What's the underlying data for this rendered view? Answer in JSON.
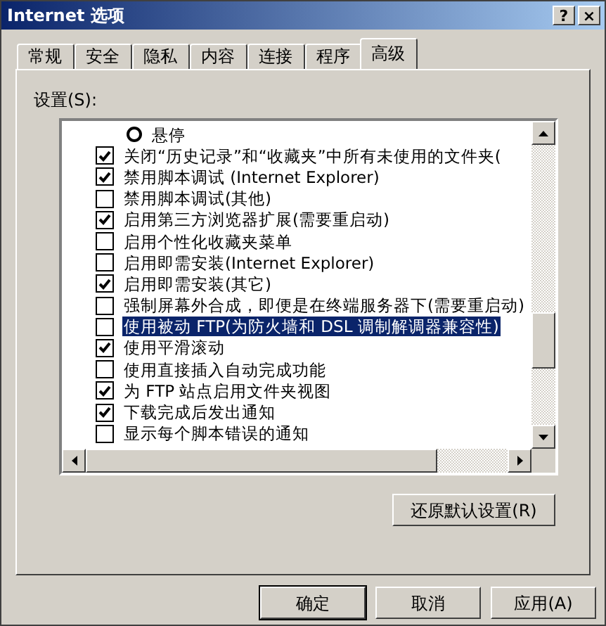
{
  "window": {
    "title": "Internet 选项",
    "title_buttons": [
      "?",
      "×"
    ]
  },
  "tabs": [
    {
      "label": "常规",
      "selected": false
    },
    {
      "label": "安全",
      "selected": false
    },
    {
      "label": "隐私",
      "selected": false
    },
    {
      "label": "内容",
      "selected": false
    },
    {
      "label": "连接",
      "selected": false
    },
    {
      "label": "程序",
      "selected": false
    },
    {
      "label": "高级",
      "selected": true
    }
  ],
  "settings_label": "设置(S):",
  "settings": [
    {
      "kind": "radio",
      "label": "悬停",
      "checked": false,
      "selected": false
    },
    {
      "kind": "checkbox",
      "label": "关闭“历史记录”和“收藏夹”中所有未使用的文件夹(",
      "checked": true,
      "selected": false
    },
    {
      "kind": "checkbox",
      "label": "禁用脚本调试 (Internet Explorer)",
      "checked": true,
      "selected": false
    },
    {
      "kind": "checkbox",
      "label": "禁用脚本调试(其他)",
      "checked": false,
      "selected": false
    },
    {
      "kind": "checkbox",
      "label": "启用第三方浏览器扩展(需要重启动)",
      "checked": true,
      "selected": false
    },
    {
      "kind": "checkbox",
      "label": "启用个性化收藏夹菜单",
      "checked": false,
      "selected": false
    },
    {
      "kind": "checkbox",
      "label": "启用即需安装(Internet Explorer)",
      "checked": false,
      "selected": false
    },
    {
      "kind": "checkbox",
      "label": "启用即需安装(其它)",
      "checked": true,
      "selected": false
    },
    {
      "kind": "checkbox",
      "label": "强制屏幕外合成，即便是在终端服务器下(需要重启动)",
      "checked": false,
      "selected": false
    },
    {
      "kind": "checkbox",
      "label": "使用被动 FTP(为防火墙和 DSL 调制解调器兼容性)",
      "checked": false,
      "selected": true
    },
    {
      "kind": "checkbox",
      "label": "使用平滑滚动",
      "checked": true,
      "selected": false
    },
    {
      "kind": "checkbox",
      "label": "使用直接插入自动完成功能",
      "checked": false,
      "selected": false
    },
    {
      "kind": "checkbox",
      "label": "为 FTP 站点启用文件夹视图",
      "checked": true,
      "selected": false
    },
    {
      "kind": "checkbox",
      "label": "下载完成后发出通知",
      "checked": true,
      "selected": false
    },
    {
      "kind": "checkbox",
      "label": "显示每个脚本错误的通知",
      "checked": false,
      "selected": false
    }
  ],
  "restore_button": "还原默认设置(R)",
  "buttons": [
    {
      "label": "确定",
      "default": true
    },
    {
      "label": "取消",
      "default": false
    },
    {
      "label": "应用(A)",
      "default": false
    }
  ]
}
